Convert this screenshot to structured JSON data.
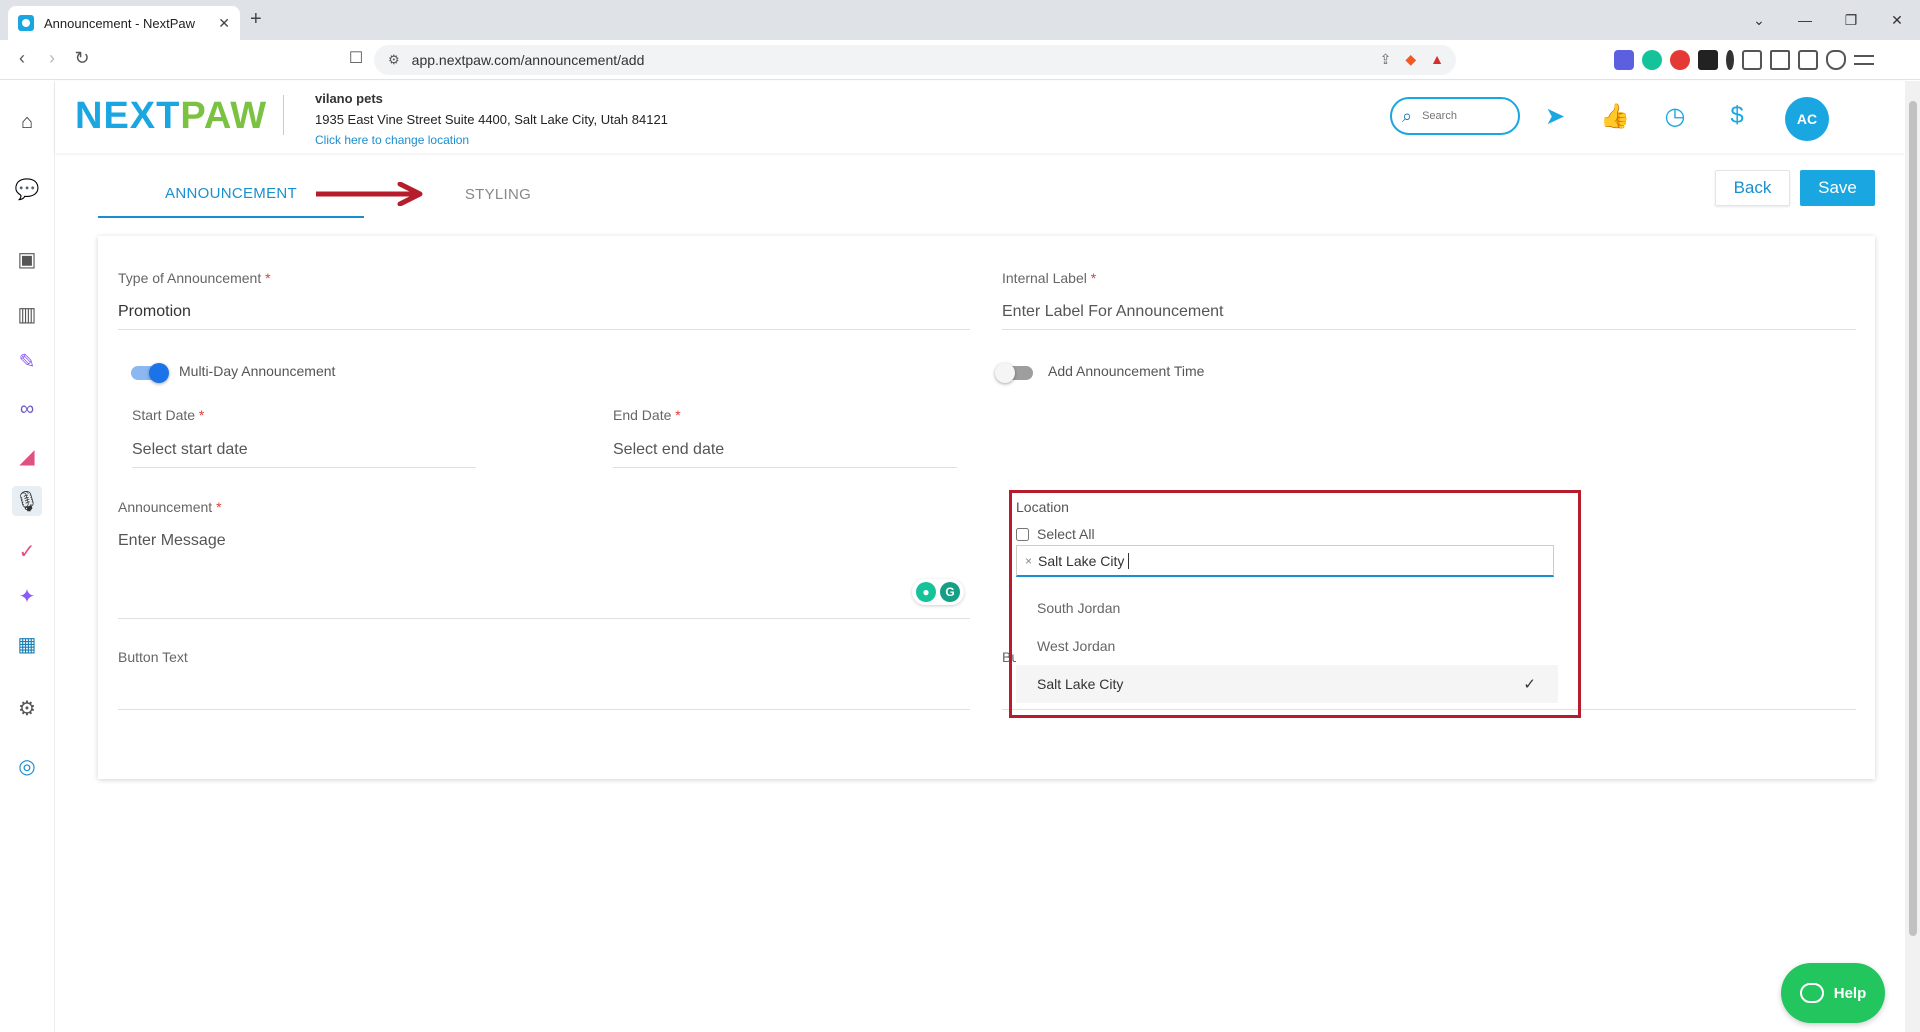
{
  "browser": {
    "tab_title": "Announcement - NextPaw",
    "url": "app.nextpaw.com/announcement/add"
  },
  "header": {
    "logo_next": "NEXT",
    "logo_paw": "PAW",
    "business_name": "vilano pets",
    "business_address": "1935 East Vine Street Suite 4400, Salt Lake City, Utah 84121",
    "change_location_link": "Click here to change location",
    "search_placeholder": "Search",
    "avatar_initials": "AC"
  },
  "tabs": {
    "announcement": "ANNOUNCEMENT",
    "styling": "STYLING"
  },
  "actions": {
    "back": "Back",
    "save": "Save"
  },
  "form": {
    "type_label": "Type of Announcement",
    "type_value": "Promotion",
    "internal_label": "Internal Label",
    "internal_placeholder": "Enter Label For Announcement",
    "multi_day_label": "Multi-Day Announcement",
    "multi_day_on": true,
    "add_time_label": "Add Announcement Time",
    "add_time_on": false,
    "start_date_label": "Start Date",
    "start_date_placeholder": "Select start date",
    "end_date_label": "End Date",
    "end_date_placeholder": "Select end date",
    "announcement_label": "Announcement",
    "announcement_placeholder": "Enter Message",
    "button_text_label": "Button Text",
    "required_mark": "*",
    "hidden_label_fragment": "Bu"
  },
  "location": {
    "label": "Location",
    "select_all": "Select All",
    "chip_remove": "×",
    "chip_value": "Salt Lake City",
    "options": [
      {
        "label": "South Jordan",
        "selected": false
      },
      {
        "label": "West Jordan",
        "selected": false
      },
      {
        "label": "Salt Lake City",
        "selected": true
      }
    ],
    "check_mark": "✓"
  },
  "help": {
    "label": "Help"
  },
  "colors": {
    "brand_blue": "#1aa6e0",
    "brand_green": "#7cc242",
    "highlight_red": "#b71c2c",
    "help_green": "#22c55e"
  }
}
